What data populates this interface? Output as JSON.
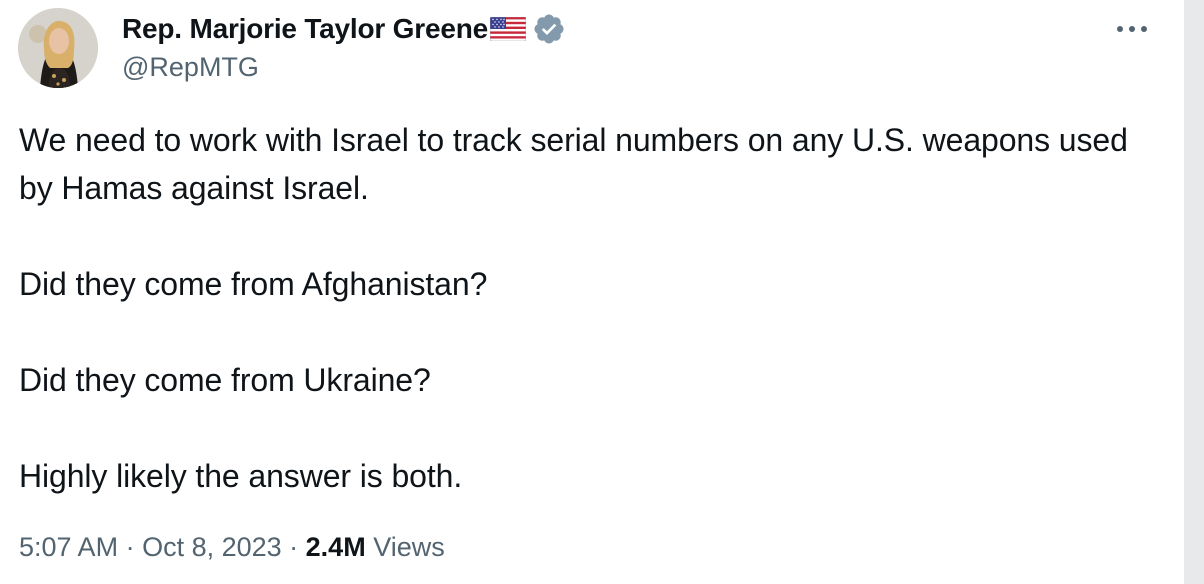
{
  "author": {
    "display_name": "Rep. Marjorie Taylor Greene",
    "handle": "@RepMTG",
    "verified": true,
    "name_emoji": "us-flag-icon",
    "verified_badge": "verified-badge-icon",
    "verified_color": "#829aab"
  },
  "menu": {
    "more_icon": "more-horizontal-icon"
  },
  "tweet": {
    "paragraphs": [
      "We need to work with Israel to track serial numbers on any U.S. weapons used by Hamas against Israel.",
      "Did they come from Afghanistan?",
      "Did they come from Ukraine?",
      "Highly likely the answer is both."
    ]
  },
  "meta": {
    "time": "5:07 AM",
    "separator": " · ",
    "date": "Oct 8, 2023",
    "views_count": "2.4M",
    "views_label": "Views"
  },
  "colors": {
    "text_primary": "#0f1419",
    "text_secondary": "#536471"
  }
}
